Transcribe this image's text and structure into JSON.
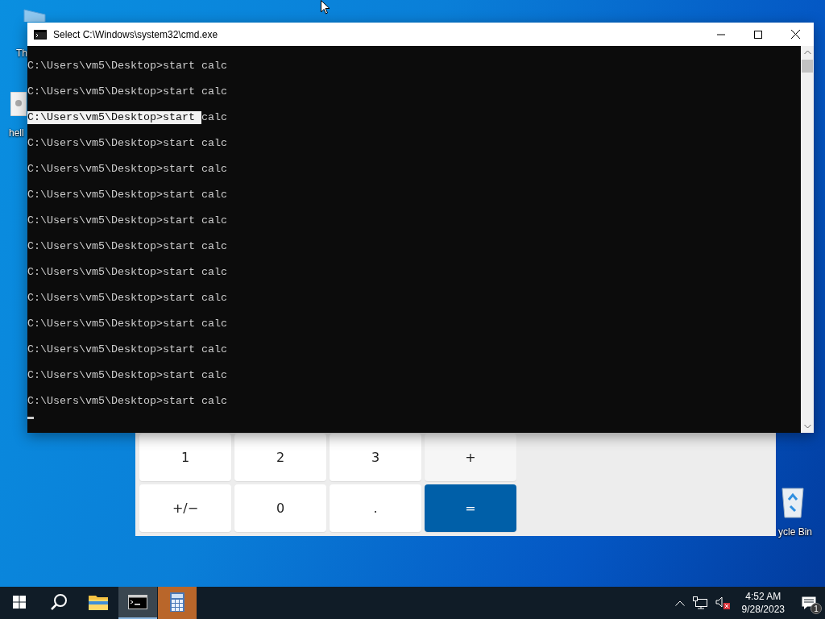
{
  "desktop": {
    "icons": [
      {
        "kind": "folder",
        "label": "Th"
      },
      {
        "kind": "file",
        "label": "hell"
      },
      {
        "kind": "recycle",
        "label": "ycle Bin"
      }
    ]
  },
  "calculator": {
    "keys": [
      {
        "label": "1",
        "kind": "digit"
      },
      {
        "label": "2",
        "kind": "digit"
      },
      {
        "label": "3",
        "kind": "digit"
      },
      {
        "label": "+",
        "kind": "operator"
      },
      {
        "label": "+/−",
        "kind": "digit"
      },
      {
        "label": "0",
        "kind": "digit"
      },
      {
        "label": ".",
        "kind": "digit"
      },
      {
        "label": "=",
        "kind": "equals"
      }
    ]
  },
  "cmd_window": {
    "title": "Select C:\\Windows\\system32\\cmd.exe",
    "lines": [
      {
        "parts": [
          {
            "text": "C:\\Users\\vm5\\Desktop>start calc",
            "selected": false
          }
        ]
      },
      {
        "parts": [
          {
            "text": "C:\\Users\\vm5\\Desktop>start calc",
            "selected": false
          }
        ]
      },
      {
        "parts": [
          {
            "text": "C:\\Users\\vm5\\Desktop>start ",
            "selected": true
          },
          {
            "text": "calc",
            "selected": false
          }
        ]
      },
      {
        "parts": [
          {
            "text": "C:\\Users\\vm5\\Desktop>start calc",
            "selected": false
          }
        ]
      },
      {
        "parts": [
          {
            "text": "C:\\Users\\vm5\\Desktop>start calc",
            "selected": false
          }
        ]
      },
      {
        "parts": [
          {
            "text": "C:\\Users\\vm5\\Desktop>start calc",
            "selected": false
          }
        ]
      },
      {
        "parts": [
          {
            "text": "C:\\Users\\vm5\\Desktop>start calc",
            "selected": false
          }
        ]
      },
      {
        "parts": [
          {
            "text": "C:\\Users\\vm5\\Desktop>start calc",
            "selected": false
          }
        ]
      },
      {
        "parts": [
          {
            "text": "C:\\Users\\vm5\\Desktop>start calc",
            "selected": false
          }
        ]
      },
      {
        "parts": [
          {
            "text": "C:\\Users\\vm5\\Desktop>start calc",
            "selected": false
          }
        ]
      },
      {
        "parts": [
          {
            "text": "C:\\Users\\vm5\\Desktop>start calc",
            "selected": false
          }
        ]
      },
      {
        "parts": [
          {
            "text": "C:\\Users\\vm5\\Desktop>start calc",
            "selected": false
          }
        ]
      },
      {
        "parts": [
          {
            "text": "C:\\Users\\vm5\\Desktop>start calc",
            "selected": false
          }
        ]
      },
      {
        "parts": [
          {
            "text": "C:\\Users\\vm5\\Desktop>start calc",
            "selected": false
          }
        ]
      }
    ]
  },
  "taskbar": {
    "apps": [
      {
        "kind": "explorer",
        "active": false,
        "attention": false
      },
      {
        "kind": "terminal",
        "active": true,
        "attention": false
      },
      {
        "kind": "calculator",
        "active": false,
        "attention": true
      }
    ],
    "tray": {
      "time": "4:52 AM",
      "date": "9/28/2023",
      "notification_count": "1"
    }
  }
}
